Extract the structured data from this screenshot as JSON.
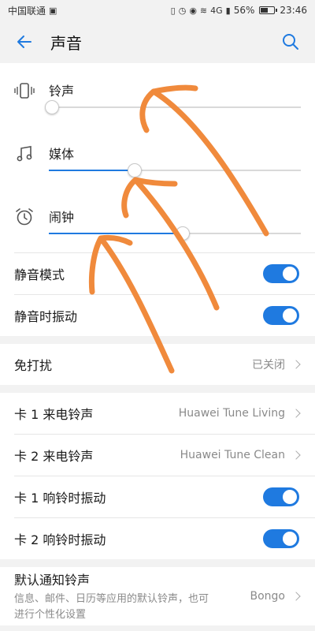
{
  "status_bar": {
    "carrier": "中国联通",
    "battery": "56%",
    "time": "23:46",
    "network": "4G"
  },
  "header": {
    "title": "声音",
    "back_icon": "arrow-left-icon",
    "search_icon": "search-icon"
  },
  "volumes": [
    {
      "label": "铃声",
      "icon": "vibrate-phone-icon",
      "level": 0.0
    },
    {
      "label": "媒体",
      "icon": "music-note-icon",
      "level": 0.34
    },
    {
      "label": "闹钟",
      "icon": "alarm-clock-icon",
      "level": 0.53
    }
  ],
  "toggles": [
    {
      "label": "静音模式",
      "on": true
    },
    {
      "label": "静音时振动",
      "on": true
    }
  ],
  "dnd": {
    "label": "免打扰",
    "value": "已关闭"
  },
  "ringtones": [
    {
      "label": "卡 1 来电铃声",
      "value": "Huawei Tune Living"
    },
    {
      "label": "卡 2 来电铃声",
      "value": "Huawei Tune Clean"
    }
  ],
  "vibrate_toggles": [
    {
      "label": "卡 1 响铃时振动",
      "on": true
    },
    {
      "label": "卡 2 响铃时振动",
      "on": true
    }
  ],
  "notification": {
    "title": "默认通知铃声",
    "desc": "信息、邮件、日历等应用的默认铃声，也可进行个性化设置",
    "value": "Bongo"
  },
  "colors": {
    "accent": "#1f7ae0",
    "annotation": "#f08a3c"
  }
}
